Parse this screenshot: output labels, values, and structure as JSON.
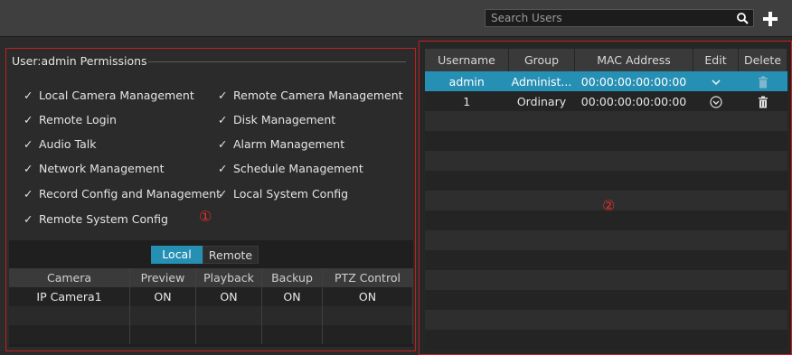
{
  "search": {
    "placeholder": "Search Users"
  },
  "permissions": {
    "title": "User:admin Permissions",
    "items": [
      "Local Camera Management",
      "Remote Camera Management",
      "Remote Login",
      "Disk Management",
      "Audio Talk",
      "Alarm Management",
      "Network Management",
      "Schedule Management",
      "Record Config and Management",
      "Local System Config",
      "Remote System Config"
    ],
    "check_glyph": "✓"
  },
  "annotations": {
    "left": "①",
    "right": "②"
  },
  "camera_tabs": {
    "local": "Local",
    "remote": "Remote"
  },
  "camera_table": {
    "headers": [
      "Camera",
      "Preview",
      "Playback",
      "Backup",
      "PTZ Control"
    ],
    "rows": [
      [
        "IP Camera1",
        "ON",
        "ON",
        "ON",
        "ON"
      ]
    ]
  },
  "user_table": {
    "headers": [
      "Username",
      "Group",
      "MAC Address",
      "Edit",
      "Delete"
    ],
    "rows": [
      [
        "admin",
        "Administ...",
        "00:00:00:00:00:00"
      ],
      [
        "1",
        "Ordinary",
        "00:00:00:00:00:00"
      ]
    ]
  },
  "colors": {
    "accent": "#2690b4",
    "highlight_border": "#c61e1e",
    "annotation": "#e0302a"
  },
  "icons": {
    "search": "search-icon",
    "add": "plus-icon",
    "edit": "chevron-down-icon",
    "delete": "trash-icon"
  }
}
